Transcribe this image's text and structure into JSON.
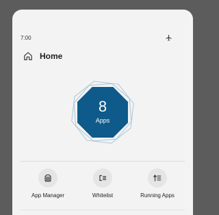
{
  "status_bar": {
    "time": "7:00",
    "airplane_icon": "airplane-icon"
  },
  "app_bar": {
    "home_icon": "home-icon",
    "title": "Home"
  },
  "summary": {
    "count": "8",
    "unit": "Apps",
    "badge_color": "#0e5a8a",
    "ring_color": "#a9c7dd"
  },
  "actions": [
    {
      "label": "App Manager",
      "icon": "app-manager-icon"
    },
    {
      "label": "Whitelist",
      "icon": "whitelist-icon"
    },
    {
      "label": "Running Apps",
      "icon": "running-apps-icon"
    }
  ],
  "colors": {
    "background": "#5c5c5c",
    "surface": "#f3f3f3",
    "action_circle": "#e5e5e5"
  }
}
